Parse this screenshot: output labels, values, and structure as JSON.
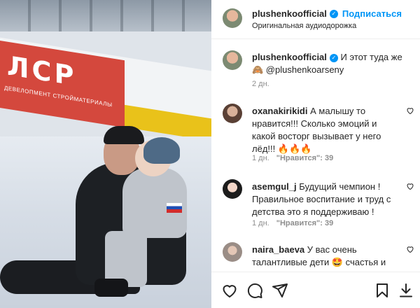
{
  "media": {
    "banner_logo": "ЛСР",
    "banner_subtitle": "ДЕВЕЛОПМЕНТ СТРОЙМАТЕРИАЛЫ"
  },
  "header": {
    "username": "plushenkoofficial",
    "follow_label": "Подписаться",
    "audio_label": "Оригинальная аудиодорожка"
  },
  "caption": {
    "username": "plushenkoofficial",
    "text": "И этот туда же 🙈 @plushenkoarseny",
    "time": "2 дн."
  },
  "comments": [
    {
      "username": "oxanakirikidi",
      "text": "А малышу то нравится!!! Сколько эмоций и какой восторг вызывает у него лёд!!! 🔥🔥🔥",
      "time": "1 дн.",
      "likes_label": "\"Нравится\": 39"
    },
    {
      "username": "asemgul_j",
      "text": "Будущий чемпион ! Правильное воспитание и труд с детства это я поддерживаю !",
      "time": "1 дн.",
      "likes_label": "\"Нравится\": 39"
    },
    {
      "username": "naira_baeva",
      "text": "У вас очень талантливые дети 🤩 счастья и"
    }
  ],
  "icons": {
    "like": "heart-icon",
    "comment": "comment-icon",
    "share": "share-icon",
    "save": "bookmark-icon",
    "download": "download-icon",
    "verified": "verified-badge-icon"
  },
  "colors": {
    "accent": "#0095f6",
    "meta": "#8e8e8e",
    "text": "#262626"
  }
}
